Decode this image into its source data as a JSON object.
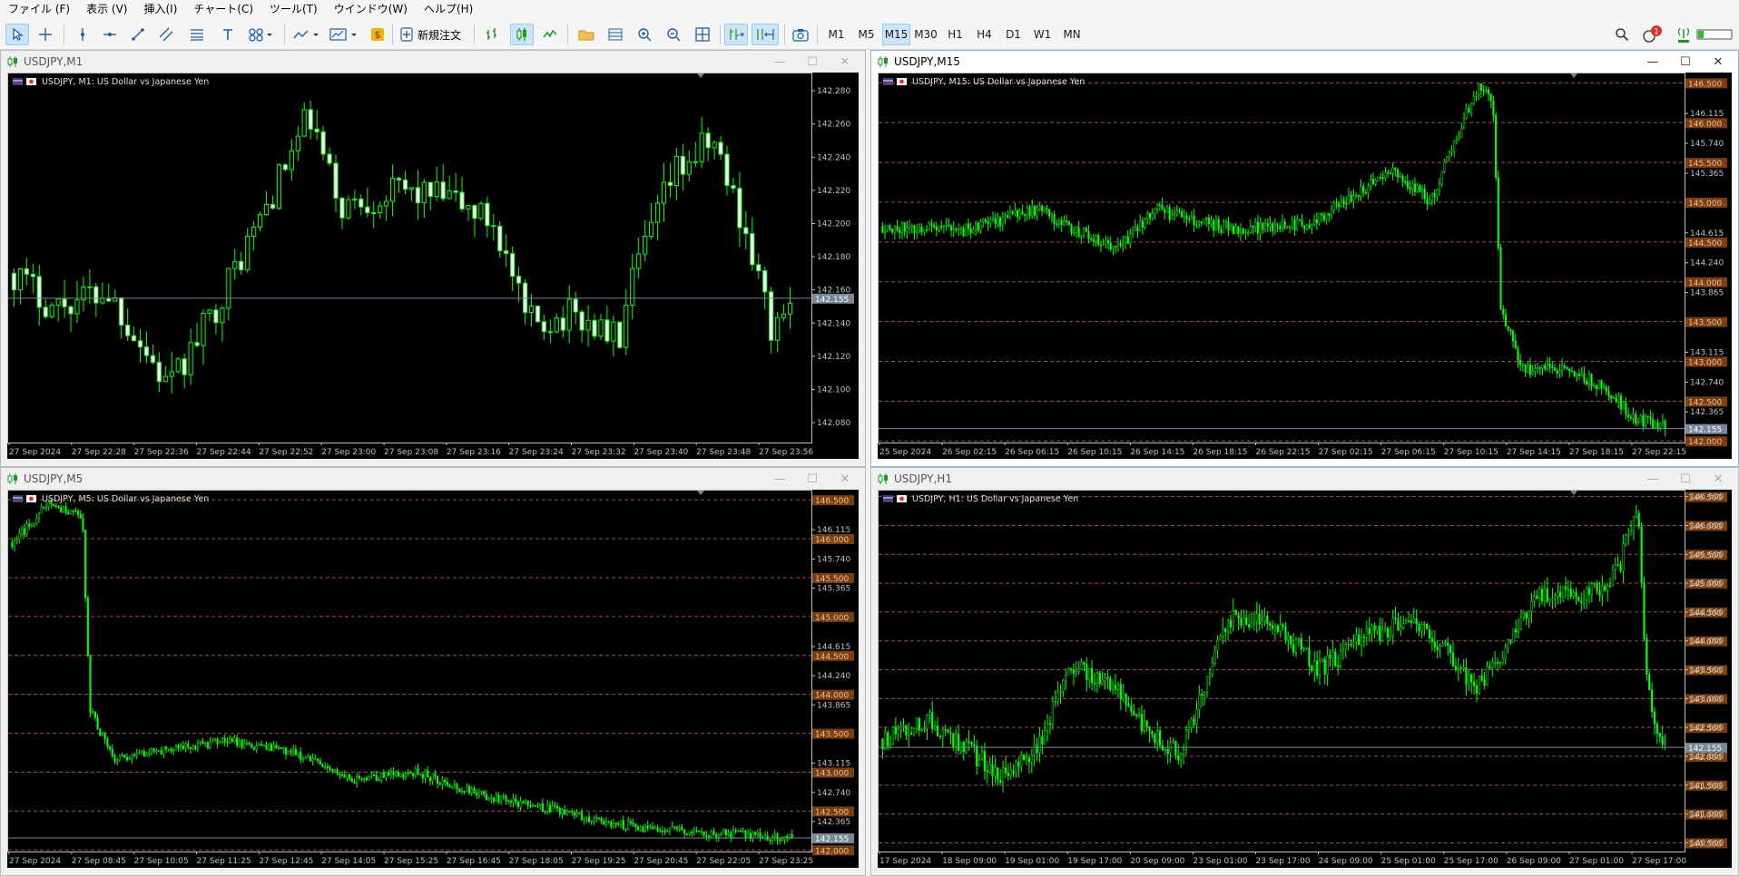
{
  "menu": [
    "ファイル (F)",
    "表示 (V)",
    "挿入(I)",
    "チャート(C)",
    "ツール(T)",
    "ウインドウ(W)",
    "ヘルプ(H)"
  ],
  "toolbar": {
    "new_order_label": "新規注文",
    "timeframes": [
      "M1",
      "M5",
      "M15",
      "M30",
      "H1",
      "H4",
      "D1",
      "W1",
      "MN"
    ],
    "active_timeframe": "M15",
    "notification_count": "1"
  },
  "colors": {
    "chart_bg": "#000000",
    "candle": "#00ff00",
    "bid_line": "#778899",
    "grid_level": "#a0522d",
    "axis_text": "#c0c0c0"
  },
  "charts": [
    {
      "window_title": "USDJPY,M1",
      "chart_label": "USDJPY, M1:  US Dollar vs Japanese Yen",
      "active": false,
      "current_price": "142.155",
      "price_ticks": [
        "142.280",
        "142.260",
        "142.240",
        "142.220",
        "142.200",
        "142.180",
        "142.160",
        "142.140",
        "142.120",
        "142.100",
        "142.080"
      ],
      "level_boxes": [],
      "time_labels": [
        "27 Sep 2024",
        "27 Sep 22:28",
        "27 Sep 22:36",
        "27 Sep 22:44",
        "27 Sep 22:52",
        "27 Sep 23:00",
        "27 Sep 23:08",
        "27 Sep 23:16",
        "27 Sep 23:24",
        "27 Sep 23:32",
        "27 Sep 23:40",
        "27 Sep 23:48",
        "27 Sep 23:56"
      ]
    },
    {
      "window_title": "USDJPY,M15",
      "chart_label": "USDJPY, M15:  US Dollar vs Japanese Yen",
      "active": true,
      "current_price": "142.155",
      "price_ticks": [
        "146.115",
        "145.740",
        "145.365",
        "144.615",
        "144.240",
        "143.865",
        "143.115",
        "142.740",
        "142.365"
      ],
      "level_boxes": [
        "146.500",
        "146.000",
        "145.500",
        "145.000",
        "144.500",
        "144.000",
        "143.500",
        "143.000",
        "142.500",
        "142.000"
      ],
      "time_labels": [
        "25 Sep 2024",
        "26 Sep 02:15",
        "26 Sep 06:15",
        "26 Sep 10:15",
        "26 Sep 14:15",
        "26 Sep 18:15",
        "26 Sep 22:15",
        "27 Sep 02:15",
        "27 Sep 06:15",
        "27 Sep 10:15",
        "27 Sep 14:15",
        "27 Sep 18:15",
        "27 Sep 22:15"
      ]
    },
    {
      "window_title": "USDJPY,M5",
      "chart_label": "USDJPY, M5:  US Dollar vs Japanese Yen",
      "active": false,
      "current_price": "142.155",
      "price_ticks": [
        "146.115",
        "145.740",
        "145.365",
        "144.615",
        "144.240",
        "143.865",
        "143.115",
        "142.740",
        "142.365"
      ],
      "level_boxes": [
        "146.500",
        "146.000",
        "145.500",
        "145.000",
        "144.500",
        "144.000",
        "143.500",
        "143.000",
        "142.500",
        "142.000"
      ],
      "time_labels": [
        "27 Sep 2024",
        "27 Sep 08:45",
        "27 Sep 10:05",
        "27 Sep 11:25",
        "27 Sep 12:45",
        "27 Sep 14:05",
        "27 Sep 15:25",
        "27 Sep 16:45",
        "27 Sep 18:05",
        "27 Sep 19:25",
        "27 Sep 20:45",
        "27 Sep 22:05",
        "27 Sep 23:25"
      ]
    },
    {
      "window_title": "USDJPY,H1",
      "chart_label": "USDJPY, H1:  US Dollar vs Japanese Yen",
      "active": false,
      "current_price": "142.155",
      "price_ticks": [
        "146.500",
        "146.000",
        "145.500",
        "145.000",
        "144.500",
        "144.000",
        "143.500",
        "143.000",
        "142.500",
        "142.000",
        "141.500",
        "141.000",
        "140.500"
      ],
      "level_boxes": [
        "146.500",
        "146.000",
        "145.500",
        "145.000",
        "144.500",
        "144.000",
        "143.500",
        "143.000",
        "142.500",
        "142.000",
        "141.500",
        "141.000",
        "140.500"
      ],
      "time_labels": [
        "17 Sep 2024",
        "18 Sep 09:00",
        "19 Sep 01:00",
        "19 Sep 17:00",
        "20 Sep 09:00",
        "23 Sep 01:00",
        "23 Sep 17:00",
        "24 Sep 09:00",
        "25 Sep 01:00",
        "25 Sep 17:00",
        "26 Sep 09:00",
        "27 Sep 01:00",
        "27 Sep 17:00"
      ]
    }
  ]
}
